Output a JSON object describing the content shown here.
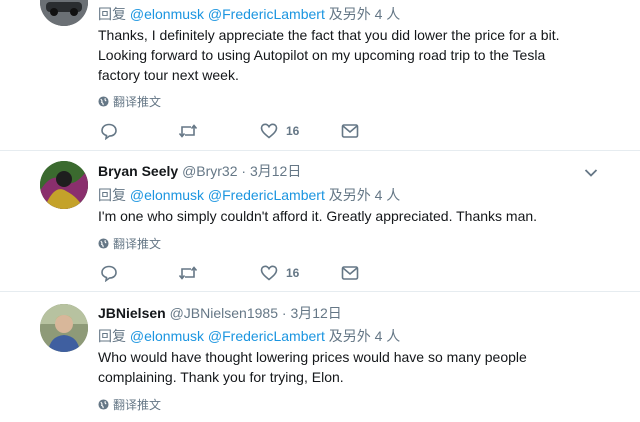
{
  "tweets": [
    {
      "name": "",
      "handle": "",
      "date": "",
      "reply_prefix": "回复",
      "mentions": [
        "@elonmusk",
        "@FredericLambert"
      ],
      "reply_suffix": "及另外 4 人",
      "text": "Thanks, I definitely appreciate the fact that you did lower the price for a bit. Looking forward to using Autopilot on my upcoming road trip to the Tesla factory tour next week.",
      "translate_label": "翻译推文",
      "like_count": "16",
      "avatar_color": "#5a5e62"
    },
    {
      "name": "Bryan Seely",
      "handle": "@Bryr32",
      "date": "3月12日",
      "reply_prefix": "回复",
      "mentions": [
        "@elonmusk",
        "@FredericLambert"
      ],
      "reply_suffix": "及另外 4 人",
      "text": "I'm one who simply couldn't afford it. Greatly appreciated. Thanks man.",
      "translate_label": "翻译推文",
      "like_count": "16",
      "avatar_color": "#3f7a3a"
    },
    {
      "name": "JBNielsen",
      "handle": "@JBNielsen1985",
      "date": "3月12日",
      "reply_prefix": "回复",
      "mentions": [
        "@elonmusk",
        "@FredericLambert"
      ],
      "reply_suffix": "及另外 4 人",
      "text": "Who would have thought lowering prices would have so many people complaining. Thank you for trying, Elon.",
      "translate_label": "翻译推文",
      "avatar_color": "#7d8c6a"
    }
  ],
  "colors": {
    "link": "#1b95e0",
    "secondary": "#657786",
    "divider": "#e6ecf0"
  }
}
